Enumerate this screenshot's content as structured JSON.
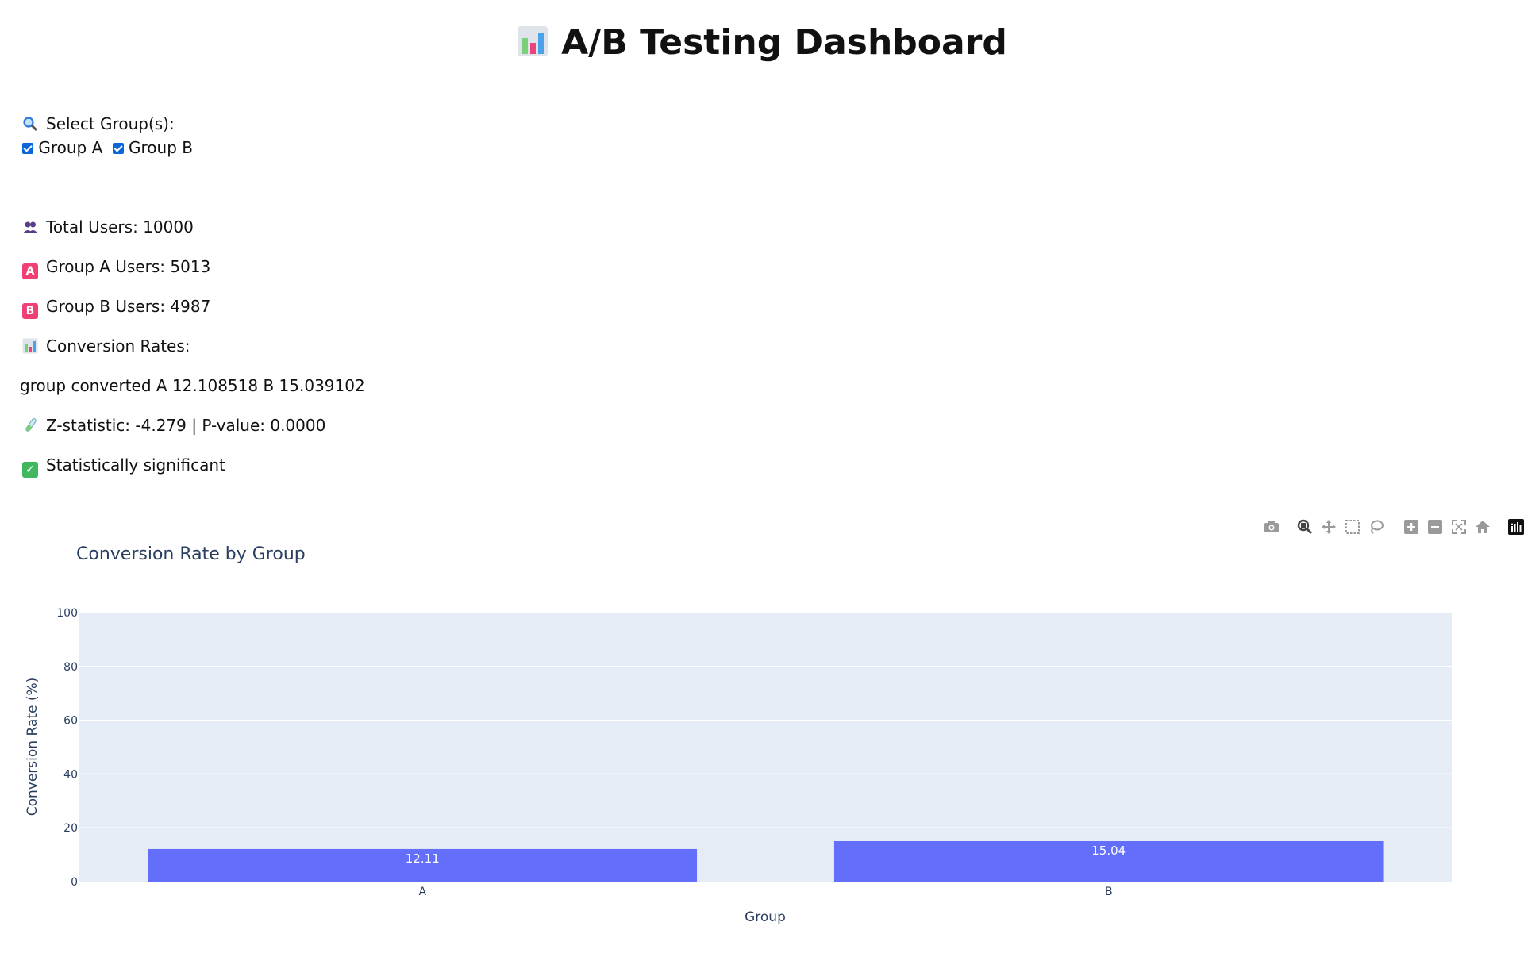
{
  "header": {
    "title": "A/B Testing Dashboard",
    "icon": "bar-chart-icon"
  },
  "filter": {
    "label": "Select Group(s):",
    "options": [
      {
        "label": "Group A",
        "checked": true
      },
      {
        "label": "Group B",
        "checked": true
      }
    ]
  },
  "stats": {
    "total_users": "Total Users: 10000",
    "group_a_users": "Group A Users: 5013",
    "group_b_users": "Group B Users: 4987",
    "conversion_rates_label": "Conversion Rates:",
    "conversion_table_text": "group converted A 12.108518 B 15.039102",
    "z_test": "Z-statistic: -4.279 | P-value: 0.0000",
    "significance": "Statistically significant"
  },
  "colors": {
    "bar": "#636efa",
    "plot_bg": "#e5ecf6",
    "axis_text": "#2a3f5f"
  },
  "modebar": [
    "camera-icon",
    "zoom-icon",
    "pan-icon",
    "box-select-icon",
    "lasso-icon",
    "zoom-in-icon",
    "zoom-out-icon",
    "autoscale-icon",
    "reset-axes-icon",
    "plotly-logo-icon"
  ],
  "chart_data": {
    "type": "bar",
    "title": "Conversion Rate by Group",
    "xlabel": "Group",
    "ylabel": "Conversion Rate (%)",
    "categories": [
      "A",
      "B"
    ],
    "values": [
      12.11,
      15.04
    ],
    "data_labels": [
      "12.11",
      "15.04"
    ],
    "ylim": [
      0,
      100
    ],
    "yticks": [
      0,
      20,
      40,
      60,
      80,
      100
    ],
    "grid": true
  }
}
